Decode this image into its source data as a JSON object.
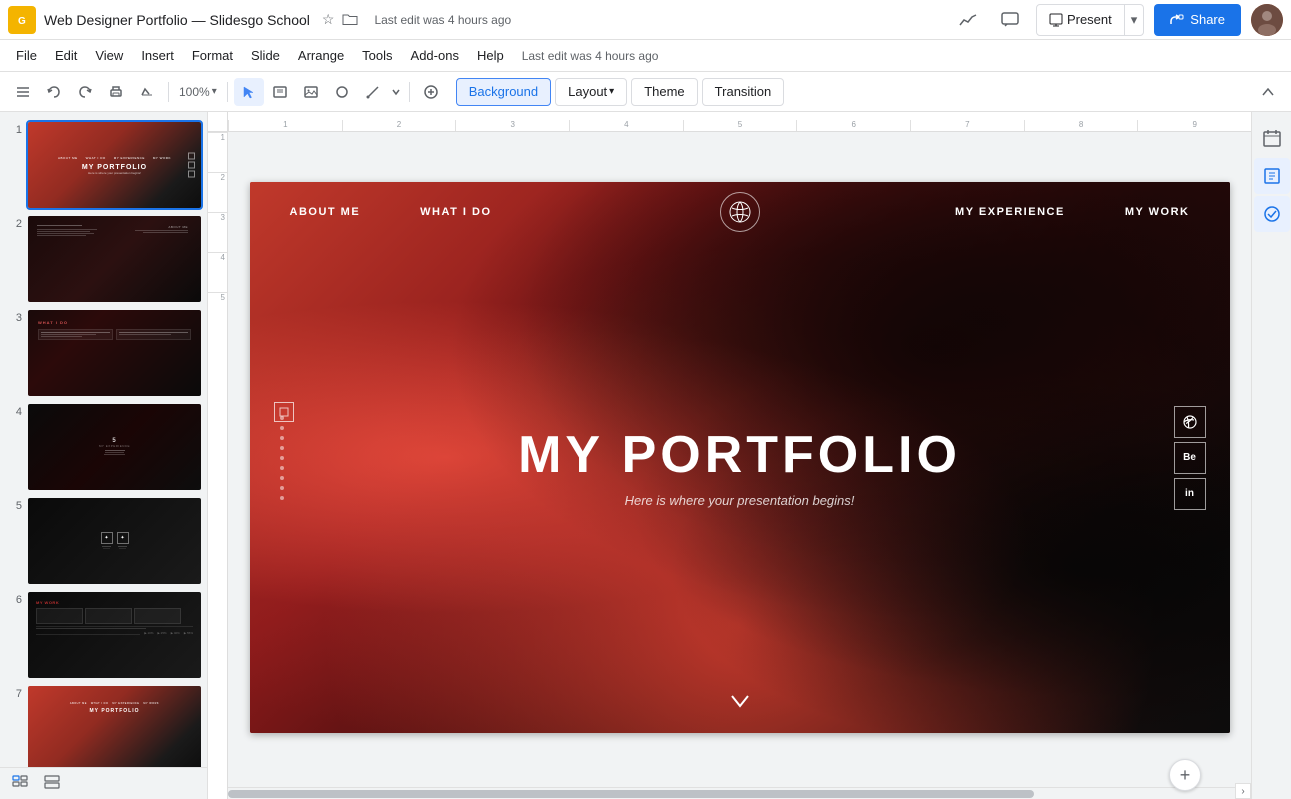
{
  "app": {
    "icon": "G",
    "title": "Web Designer Portfolio — Slidesgo School",
    "last_edit": "Last edit was 4 hours ago"
  },
  "header": {
    "star_icon": "★",
    "folder_icon": "📁",
    "trend_icon": "📈",
    "comment_icon": "💬",
    "present_label": "Present",
    "present_arrow": "▾",
    "share_label": "Share",
    "lock_icon": "🔒"
  },
  "menu": {
    "items": [
      "File",
      "Edit",
      "View",
      "Insert",
      "Format",
      "Slide",
      "Arrange",
      "Tools",
      "Add-ons",
      "Help"
    ]
  },
  "toolbar": {
    "zoom_label": "100%",
    "background_label": "Background",
    "layout_label": "Layout",
    "layout_arrow": "▾",
    "theme_label": "Theme",
    "transition_label": "Transition",
    "collapse_icon": "▲"
  },
  "slides": [
    {
      "number": "1",
      "active": true
    },
    {
      "number": "2",
      "active": false
    },
    {
      "number": "3",
      "active": false
    },
    {
      "number": "4",
      "active": false
    },
    {
      "number": "5",
      "active": false
    },
    {
      "number": "6",
      "active": false
    },
    {
      "number": "7",
      "active": false
    }
  ],
  "slide_content": {
    "nav_items_left": [
      "ABOUT ME",
      "WHAT I DO"
    ],
    "nav_items_right": [
      "MY EXPERIENCE",
      "MY WORK"
    ],
    "main_title": "MY PORTFOLIO",
    "sub_title": "Here is where your presentation begins!",
    "social_icons": [
      "⊕",
      "Be",
      "in"
    ],
    "chevron": "∨"
  },
  "ruler": {
    "h_ticks": [
      "1",
      "2",
      "3",
      "4",
      "5",
      "6",
      "7",
      "8",
      "9"
    ],
    "v_ticks": [
      "1",
      "2",
      "3",
      "4",
      "5"
    ]
  },
  "right_panel": {
    "icons": [
      "📅",
      "✎",
      "✓"
    ]
  },
  "bottom": {
    "grid_view_icon": "⊞",
    "list_view_icon": "⊟",
    "add_icon": "+"
  }
}
